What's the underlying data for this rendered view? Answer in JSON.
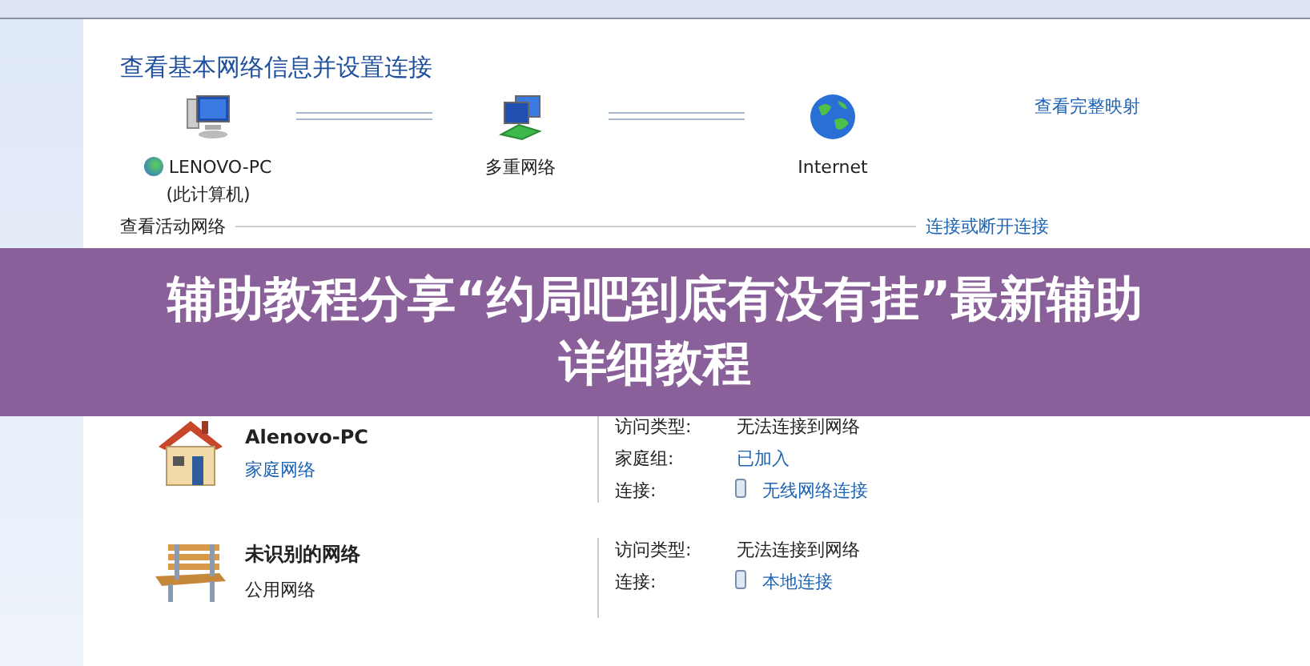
{
  "header": {
    "title": "查看基本网络信息并设置连接",
    "map_link": "查看完整映射"
  },
  "map_nodes": [
    {
      "kind": "computer",
      "label": "LENOVO-PC",
      "sublabel": "(此计算机)"
    },
    {
      "kind": "multi",
      "label": "多重网络"
    },
    {
      "kind": "globe",
      "label": "Internet"
    }
  ],
  "active_networks": {
    "title": "查看活动网络",
    "link": "连接或断开连接",
    "networks": [
      {
        "kind": "home",
        "name": "Alenovo-PC",
        "type": {
          "text": "家庭网络",
          "link": true
        },
        "details": [
          {
            "label": "访问类型:",
            "value": "无法连接到网络",
            "kind": "text"
          },
          {
            "label": "家庭组:",
            "value": "已加入",
            "kind": "link"
          },
          {
            "label": "连接:",
            "value": "无线网络连接",
            "kind": "connection"
          }
        ]
      },
      {
        "kind": "public",
        "name": "未识别的网络",
        "type": {
          "text": "公用网络",
          "link": false
        },
        "details": [
          {
            "label": "访问类型:",
            "value": "无法连接到网络",
            "kind": "text"
          },
          {
            "label": "连接:",
            "value": "本地连接",
            "kind": "connection"
          }
        ]
      }
    ]
  },
  "banner": {
    "lines": [
      "辅助教程分享“约局吧到底有没有挂”最新辅助",
      "详细教程"
    ]
  }
}
